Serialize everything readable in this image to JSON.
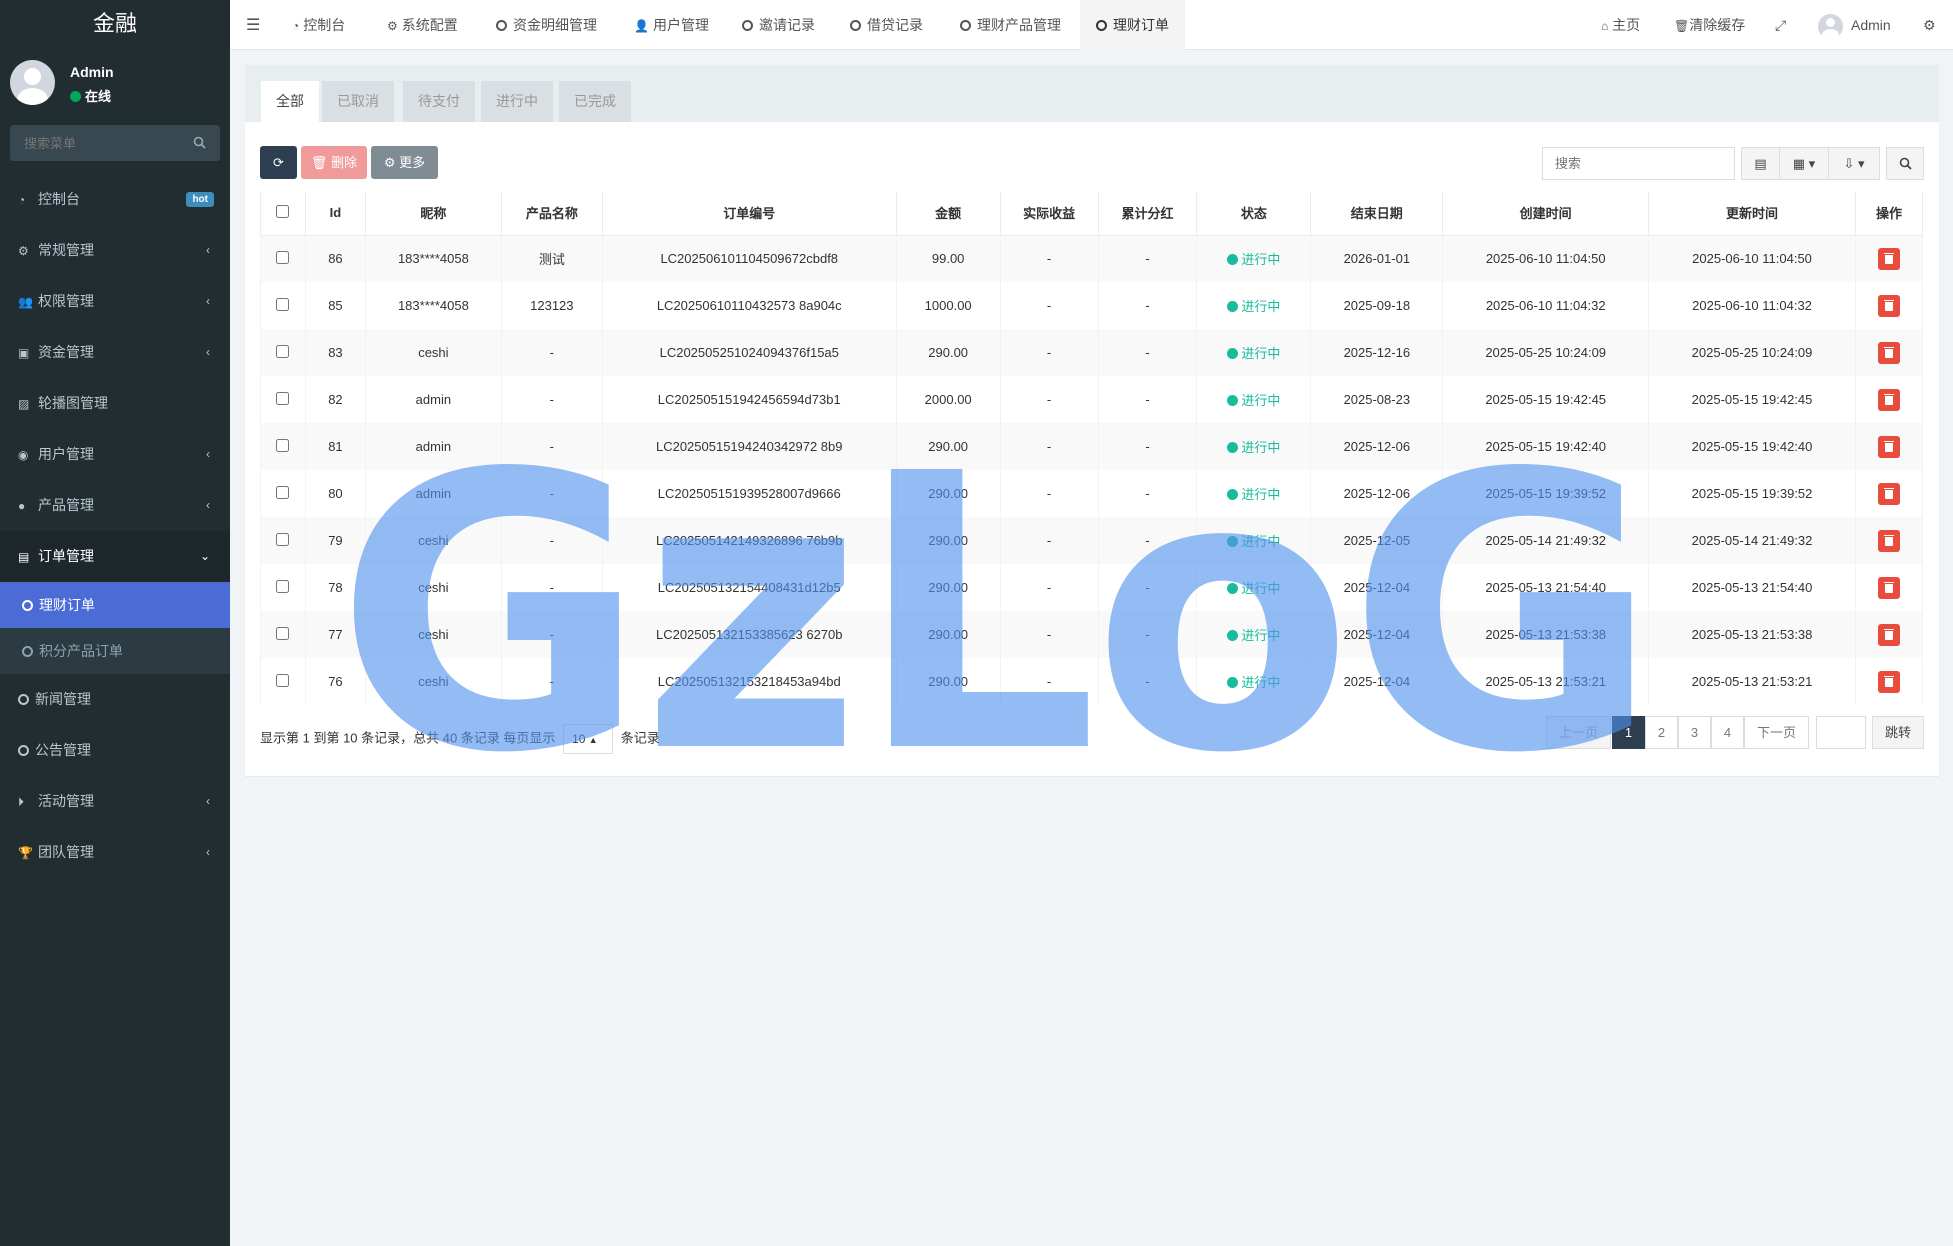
{
  "sidebar": {
    "logo": "金融",
    "user": {
      "name": "Admin",
      "status": "在线"
    },
    "search_placeholder": "搜索菜单",
    "items": [
      {
        "label": "控制台",
        "icon": "dashboard-icon",
        "badge": "hot"
      },
      {
        "label": "常规管理",
        "icon": "cogs-icon",
        "arrow": "‹"
      },
      {
        "label": "权限管理",
        "icon": "users-icon",
        "arrow": "‹"
      },
      {
        "label": "资金管理",
        "icon": "money-icon",
        "arrow": "‹"
      },
      {
        "label": "轮播图管理",
        "icon": "image-icon"
      },
      {
        "label": "用户管理",
        "icon": "user-circle-icon",
        "arrow": "‹"
      },
      {
        "label": "产品管理",
        "icon": "product-icon",
        "arrow": "‹"
      },
      {
        "label": "订单管理",
        "icon": "order-icon",
        "arrow": "⌄"
      }
    ],
    "sub_items": [
      {
        "label": "理财订单"
      },
      {
        "label": "积分产品订单"
      }
    ],
    "items_after": [
      {
        "label": "新闻管理",
        "icon": "circle-icon"
      },
      {
        "label": "公告管理",
        "icon": "circle-icon"
      },
      {
        "label": "活动管理",
        "icon": "play-circle-icon",
        "arrow": "‹"
      },
      {
        "label": "团队管理",
        "icon": "trophy-icon",
        "arrow": "‹"
      }
    ]
  },
  "navbar": {
    "tabs": [
      "控制台",
      "系统配置",
      "资金明细管理",
      "用户管理",
      "邀请记录",
      "借贷记录",
      "理财产品管理",
      "理财订单"
    ],
    "right": {
      "home": "主页",
      "clear_cache": "清除缓存",
      "user": "Admin"
    }
  },
  "panel": {
    "tabs": [
      "全部",
      "已取消",
      "待支付",
      "进行中",
      "已完成"
    ],
    "toolbar": {
      "delete": "删除",
      "more": "更多",
      "search_placeholder": "搜索"
    }
  },
  "table": {
    "headers": [
      "Id",
      "昵称",
      "产品名称",
      "订单编号",
      "金额",
      "实际收益",
      "累计分红",
      "状态",
      "结束日期",
      "创建时间",
      "更新时间",
      "操作"
    ],
    "rows": [
      [
        "86",
        "183****4058",
        "测试",
        "LC202506101104509672cbdf8",
        "99.00",
        "-",
        "-",
        "进行中",
        "2026-01-01",
        "2025-06-10 11:04:50",
        "2025-06-10 11:04:50"
      ],
      [
        "85",
        "183****4058",
        "123123",
        "LC20250610110432573 8a904c",
        "1000.00",
        "-",
        "-",
        "进行中",
        "2025-09-18",
        "2025-06-10 11:04:32",
        "2025-06-10 11:04:32"
      ],
      [
        "83",
        "ceshi",
        "-",
        "LC202505251024094376f15a5",
        "290.00",
        "-",
        "-",
        "进行中",
        "2025-12-16",
        "2025-05-25 10:24:09",
        "2025-05-25 10:24:09"
      ],
      [
        "82",
        "admin",
        "-",
        "LC202505151942456594d73b1",
        "2000.00",
        "-",
        "-",
        "进行中",
        "2025-08-23",
        "2025-05-15 19:42:45",
        "2025-05-15 19:42:45"
      ],
      [
        "81",
        "admin",
        "-",
        "LC20250515194240342972 8b9",
        "290.00",
        "-",
        "-",
        "进行中",
        "2025-12-06",
        "2025-05-15 19:42:40",
        "2025-05-15 19:42:40"
      ],
      [
        "80",
        "admin",
        "-",
        "LC202505151939528007d9666",
        "290.00",
        "-",
        "-",
        "进行中",
        "2025-12-06",
        "2025-05-15 19:39:52",
        "2025-05-15 19:39:52"
      ],
      [
        "79",
        "ceshi",
        "-",
        "LC202505142149326896 76b9b",
        "290.00",
        "-",
        "-",
        "进行中",
        "2025-12-05",
        "2025-05-14 21:49:32",
        "2025-05-14 21:49:32"
      ],
      [
        "78",
        "ceshi",
        "-",
        "LC202505132154408431d12b5",
        "290.00",
        "-",
        "-",
        "进行中",
        "2025-12-04",
        "2025-05-13 21:54:40",
        "2025-05-13 21:54:40"
      ],
      [
        "77",
        "ceshi",
        "-",
        "LC202505132153385623 6270b",
        "290.00",
        "-",
        "-",
        "进行中",
        "2025-12-04",
        "2025-05-13 21:53:38",
        "2025-05-13 21:53:38"
      ],
      [
        "76",
        "ceshi",
        "-",
        "LC202505132153218453a94bd",
        "290.00",
        "-",
        "-",
        "进行中",
        "2025-12-04",
        "2025-05-13 21:53:21",
        "2025-05-13 21:53:21"
      ]
    ]
  },
  "pagination": {
    "info_prefix": "显示第 1 到第 10 条记录，总共 40 条记录 每页显示",
    "page_size": "10",
    "info_suffix": "条记录",
    "prev": "上一页",
    "pages": [
      "1",
      "2",
      "3",
      "4"
    ],
    "next": "下一页",
    "jump": "跳转"
  },
  "watermark": "GzLoG",
  "colors": {
    "sidebar_bg": "#222d32",
    "active_sub": "#4b6cd6",
    "status_green": "#18bc9c",
    "delete_red": "#e74c3c",
    "primary_dark": "#2c3e50"
  }
}
